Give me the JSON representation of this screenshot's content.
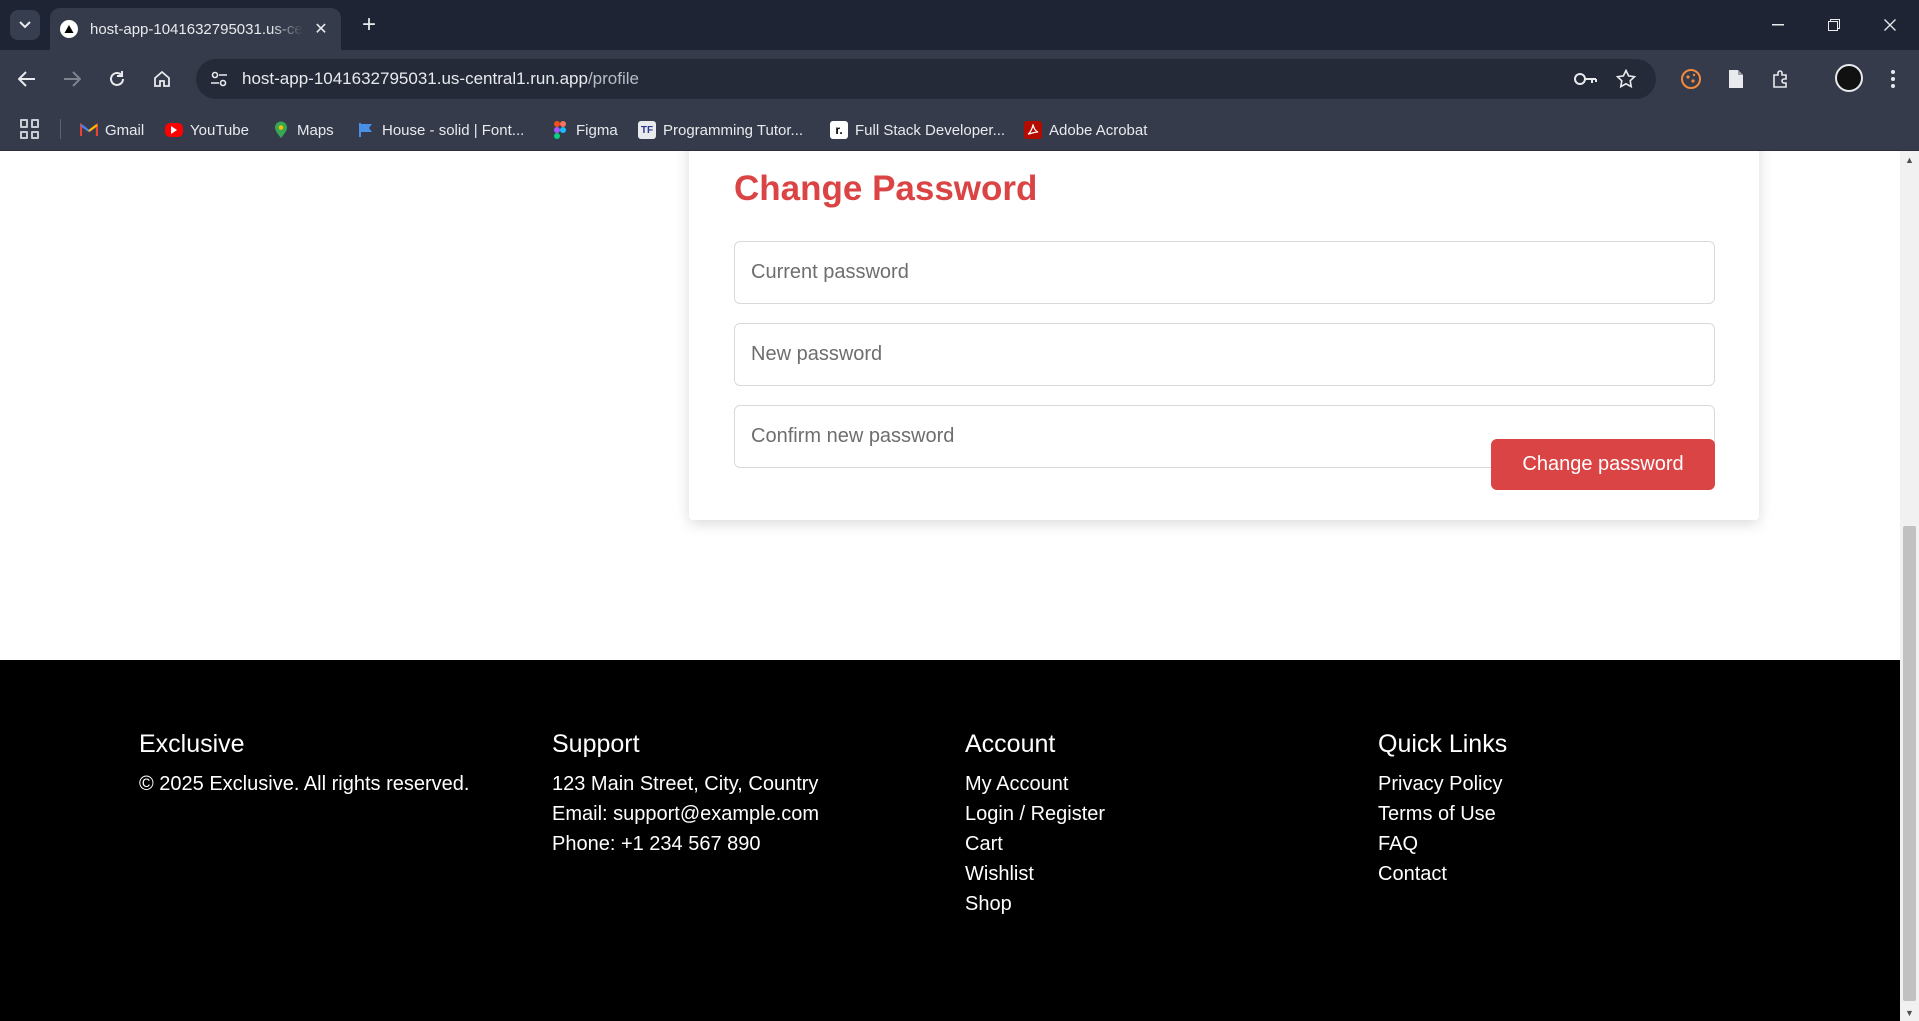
{
  "browser": {
    "tab_title": "host-app-1041632795031.us-central1.run.app/profile",
    "url_host": "host-app-1041632795031.us-central1.run.app",
    "url_path": "/profile",
    "bookmarks": [
      {
        "label": "Gmail",
        "icon": "gmail-icon"
      },
      {
        "label": "YouTube",
        "icon": "youtube-icon"
      },
      {
        "label": "Maps",
        "icon": "maps-icon"
      },
      {
        "label": "House - solid | Font...",
        "icon": "font-awesome-icon"
      },
      {
        "label": "Figma",
        "icon": "figma-icon"
      },
      {
        "label": "Programming Tutor...",
        "icon": "programming-icon"
      },
      {
        "label": "Full Stack Developer...",
        "icon": "fullstack-icon"
      },
      {
        "label": "Adobe Acrobat",
        "icon": "acrobat-icon"
      }
    ]
  },
  "change_password": {
    "title": "Change Password",
    "current_placeholder": "Current password",
    "new_placeholder": "New password",
    "confirm_placeholder": "Confirm new password",
    "submit_label": "Change password"
  },
  "footer": {
    "brand": {
      "heading": "Exclusive",
      "copyright": "© 2025 Exclusive. All rights reserved."
    },
    "support": {
      "heading": "Support",
      "address": "123 Main Street, City, Country",
      "email": "Email: support@example.com",
      "phone": "Phone: +1 234 567 890"
    },
    "account": {
      "heading": "Account",
      "links": [
        "My Account",
        "Login / Register",
        "Cart",
        "Wishlist",
        "Shop"
      ]
    },
    "quick_links": {
      "heading": "Quick Links",
      "links": [
        "Privacy Policy",
        "Terms of Use",
        "FAQ",
        "Contact"
      ]
    }
  },
  "colors": {
    "accent": "#db4444",
    "chrome_dark": "#1e2433",
    "chrome": "#353b4a",
    "footer_bg": "#000000"
  }
}
